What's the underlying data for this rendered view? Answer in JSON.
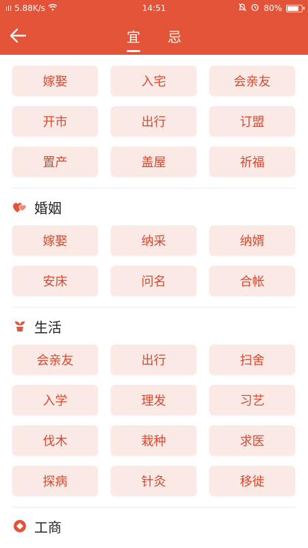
{
  "status_bar": {
    "carrier_icons": "࿢࿣.ıll",
    "speed": "5.88K/s",
    "time": "14:51",
    "battery_percent": "80%",
    "battery_level": 0.8
  },
  "header": {
    "tabs": [
      {
        "label": "宜",
        "active": true
      },
      {
        "label": "忌",
        "active": false
      }
    ]
  },
  "top_group": {
    "items": [
      "嫁娶",
      "入宅",
      "会亲友",
      "开市",
      "出行",
      "订盟",
      "置产",
      "盖屋",
      "祈福"
    ]
  },
  "sections": [
    {
      "title": "婚姻",
      "icon": "heart-icon",
      "items": [
        "嫁娶",
        "纳采",
        "纳婿",
        "安床",
        "问名",
        "合帐"
      ]
    },
    {
      "title": "生活",
      "icon": "sprout-icon",
      "items": [
        "会亲友",
        "出行",
        "扫舍",
        "入学",
        "理发",
        "习艺",
        "伐木",
        "栽种",
        "求医",
        "探病",
        "针灸",
        "移徙"
      ]
    },
    {
      "title": "工商",
      "icon": "diamond-icon",
      "items": []
    }
  ],
  "colors": {
    "primary": "#e25338",
    "chip_bg": "#fbe9e6",
    "chip_text": "#d7492f"
  }
}
